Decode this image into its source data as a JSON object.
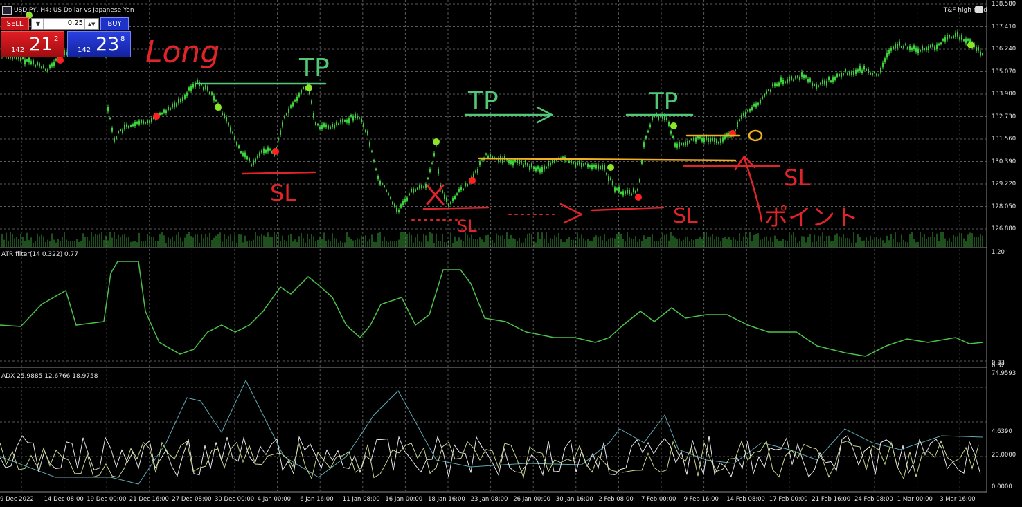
{
  "window": {
    "symbol_title": "USDJPY, H4:  US Dollar vs Japanese Yen",
    "ea_name": "T&F high road"
  },
  "trade_panel": {
    "sell_label": "SELL",
    "buy_label": "BUY",
    "lot_size": "0.25",
    "sell_prefix": "142",
    "sell_big": "21",
    "sell_sup": "2",
    "buy_prefix": "142",
    "buy_big": "23",
    "buy_sup": "8"
  },
  "price_axis": [
    "138.580",
    "137.410",
    "136.240",
    "135.070",
    "133.900",
    "132.730",
    "131.560",
    "130.390",
    "129.220",
    "128.050",
    "126.880"
  ],
  "atr_panel": {
    "title": "ATR filter(14 0.322) 0.77",
    "axis_top": "1.20",
    "axis_bottom": "0.33",
    "axis_bottom2": "0.32"
  },
  "adx_panel": {
    "title": "ADX 25.9885 12.6766 18.9758",
    "axis_top": "74.9593",
    "axis_mid": "20.0000",
    "axis_mid2": "4.6390",
    "axis_bottom": "0.0000"
  },
  "time_axis": [
    "9 Dec 2022",
    "14 Dec 08:00",
    "19 Dec 00:00",
    "21 Dec 16:00",
    "27 Dec 08:00",
    "30 Dec 00:00",
    "4 Jan 00:00",
    "6 Jan 16:00",
    "11 Jan 08:00",
    "16 Jan 00:00",
    "18 Jan 16:00",
    "23 Jan 08:00",
    "26 Jan 00:00",
    "30 Jan 16:00",
    "2 Feb 08:00",
    "7 Feb 00:00",
    "9 Feb 16:00",
    "14 Feb 08:00",
    "17 Feb 00:00",
    "21 Feb 16:00",
    "24 Feb 08:00",
    "1 Mar 00:00",
    "3 Mar 16:00"
  ],
  "annotations": {
    "long": "Long",
    "tp1": "TP",
    "tp2": "TP",
    "tp3": "TP",
    "sl1": "SL",
    "sl2": "SL",
    "sl3": "SL",
    "sl4": "SL",
    "point": "ポイント",
    "x_mark": "X"
  },
  "colors": {
    "candle": "#3cd23c",
    "atr_line": "#4cc24c",
    "adx_line": "#5fa9b4",
    "adx_plus": "#e8e8e8",
    "adx_minus": "#c8d890",
    "buy_signal": "#8ce628",
    "sell_signal": "#ff2020",
    "annot_red": "#e0242a",
    "annot_green": "#50c878",
    "annot_orange": "#f0b020",
    "grid": "#5a5a5a"
  }
}
